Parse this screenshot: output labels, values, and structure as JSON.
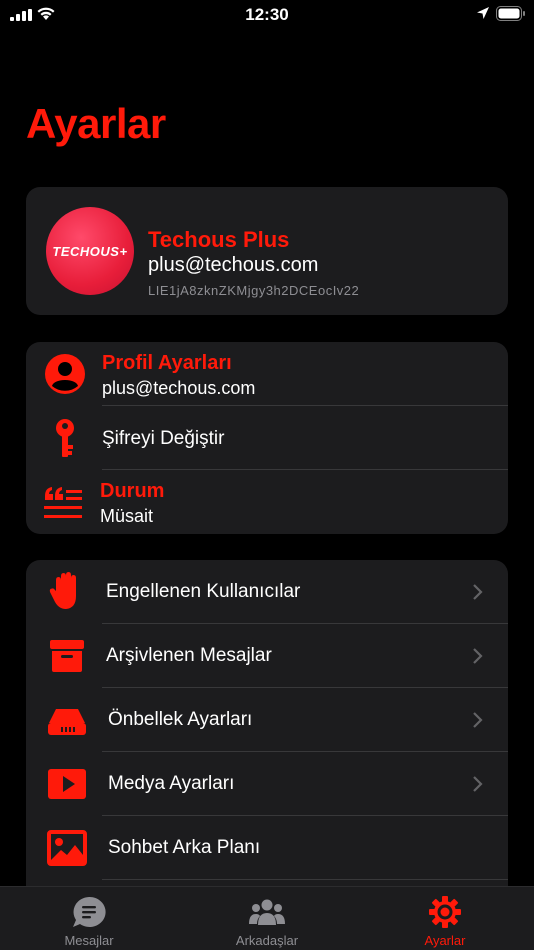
{
  "status_bar": {
    "time": "12:30"
  },
  "page_title": "Ayarlar",
  "profile": {
    "avatar_text": "TECHOUS+",
    "name": "Techous Plus",
    "email": "plus@techous.com",
    "id": "LIE1jA8zknZKMjgy3h2DCEocIv22"
  },
  "account": {
    "profile_settings": {
      "title": "Profil Ayarları",
      "subtitle": "plus@techous.com",
      "icon": "user-circle-icon"
    },
    "change_password": {
      "label": "Şifreyi Değiştir",
      "icon": "key-icon"
    },
    "status": {
      "title": "Durum",
      "subtitle": "Müsait",
      "icon": "quote-lines-icon"
    }
  },
  "settings": {
    "items": [
      {
        "label": "Engellenen Kullanıcılar",
        "icon": "hand-icon"
      },
      {
        "label": "Arşivlenen Mesajlar",
        "icon": "archive-icon"
      },
      {
        "label": "Önbellek Ayarları",
        "icon": "storage-icon"
      },
      {
        "label": "Medya Ayarları",
        "icon": "play-icon"
      },
      {
        "label": "Sohbet Arka Planı",
        "icon": "image-icon"
      }
    ]
  },
  "tabs": [
    {
      "label": "Mesajlar",
      "icon": "chat-icon",
      "active": false
    },
    {
      "label": "Arkadaşlar",
      "icon": "users-icon",
      "active": false
    },
    {
      "label": "Ayarlar",
      "icon": "gear-icon",
      "active": true
    }
  ],
  "colors": {
    "accent": "#ff1a0a",
    "card": "#1c1c1e",
    "background": "#000000"
  }
}
